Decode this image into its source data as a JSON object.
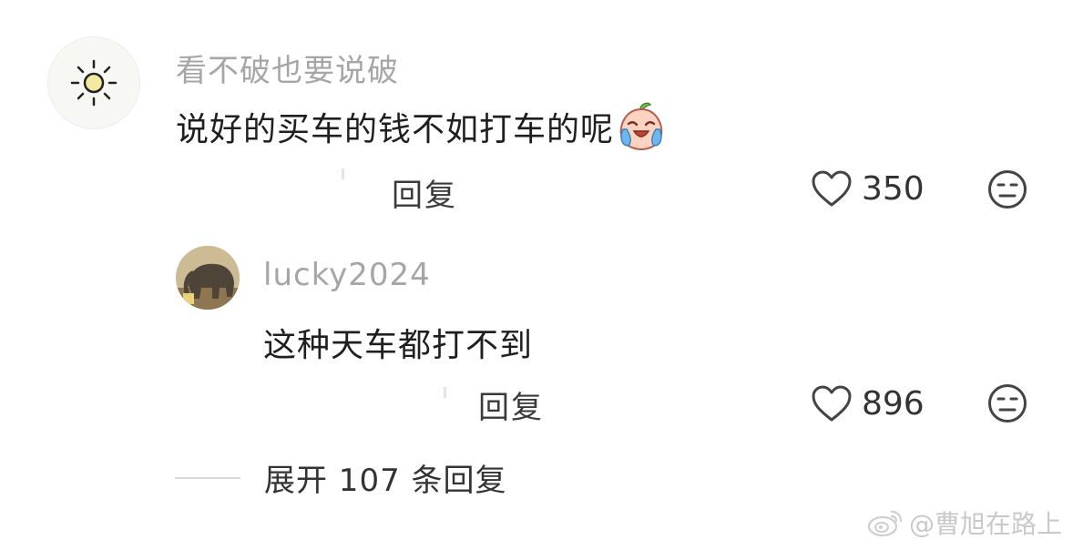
{
  "comment": {
    "username": "看不破也要说破",
    "text": "说好的买车的钱不如打车的呢",
    "emoji_icon": "crying-peach-emoji-icon",
    "reply_label": "回复",
    "like_count": "350"
  },
  "reply": {
    "username": "lucky2024",
    "text": "这种天车都打不到",
    "reply_label": "回复",
    "like_count": "896"
  },
  "expand_label": "展开 107 条回复",
  "watermark": "@曹旭在路上"
}
